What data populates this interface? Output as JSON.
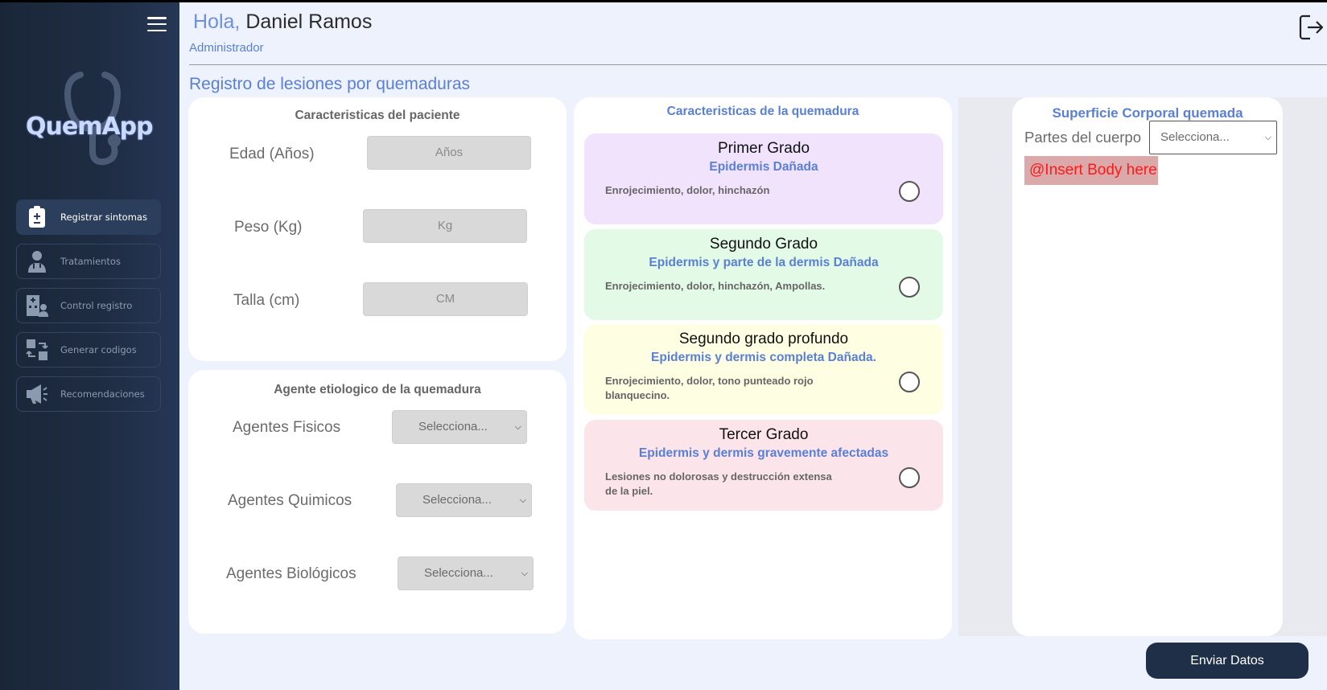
{
  "sidebar": {
    "logo_text": "QuemApp",
    "items": [
      {
        "label": "Registrar sintomas",
        "icon": "clipboard-icon",
        "active": true
      },
      {
        "label": "Tratamientos",
        "icon": "doctor-icon",
        "active": false
      },
      {
        "label": "Control registro",
        "icon": "hospital-icon",
        "active": false
      },
      {
        "label": "Generar codigos",
        "icon": "code-exchange-icon",
        "active": false
      },
      {
        "label": "Recomendaciones",
        "icon": "megaphone-icon",
        "active": false
      }
    ]
  },
  "header": {
    "greeting": "Hola,",
    "user_name": "Daniel Ramos",
    "role": "Administrador"
  },
  "page_title": "Registro de lesiones por quemaduras",
  "patient": {
    "title": "Caracteristicas del paciente",
    "fields": [
      {
        "label": "Edad (Años)",
        "placeholder": "Años"
      },
      {
        "label": "Peso (Kg)",
        "placeholder": "Kg"
      },
      {
        "label": "Talla (cm)",
        "placeholder": "CM"
      }
    ]
  },
  "agent": {
    "title": "Agente etiologico de la quemadura",
    "fields": [
      {
        "label": "Agentes Fisicos",
        "value": "Selecciona..."
      },
      {
        "label": "Agentes Quimicos",
        "value": "Selecciona..."
      },
      {
        "label": "Agentes Biológicos",
        "value": "Selecciona..."
      }
    ]
  },
  "burn": {
    "title": "Caracteristicas de la quemadura",
    "options": [
      {
        "title": "Primer Grado",
        "subtitle": "Epidermis Dañada",
        "description": "Enrojecimiento, dolor, hinchazón",
        "color": "#f1e3fc"
      },
      {
        "title": "Segundo Grado",
        "subtitle": "Epidermis y parte de la dermis Dañada",
        "description": "Enrojecimiento, dolor, hinchazón, Ampollas.",
        "color": "#e3fae6"
      },
      {
        "title": "Segundo grado profundo",
        "subtitle": "Epidermis y dermis completa Dañada.",
        "description": "Enrojecimiento, dolor, tono punteado rojo blanquecino.",
        "color": "#fefee3"
      },
      {
        "title": "Tercer Grado",
        "subtitle": "Epidermis y dermis gravemente afectadas",
        "description": "Lesiones no dolorosas y destrucción extensa de la piel.",
        "color": "#fbe5ea"
      }
    ]
  },
  "surface": {
    "title": "Superficie Corporal quemada",
    "parts_label": "Partes del cuerpo",
    "parts_value": "Selecciona...",
    "body_placeholder": "@Insert Body here"
  },
  "submit_label": "Enviar Datos",
  "colors": {
    "accent": "#5a7fd6",
    "sidebar": "#1f2d44",
    "button": "#1f2f48"
  }
}
